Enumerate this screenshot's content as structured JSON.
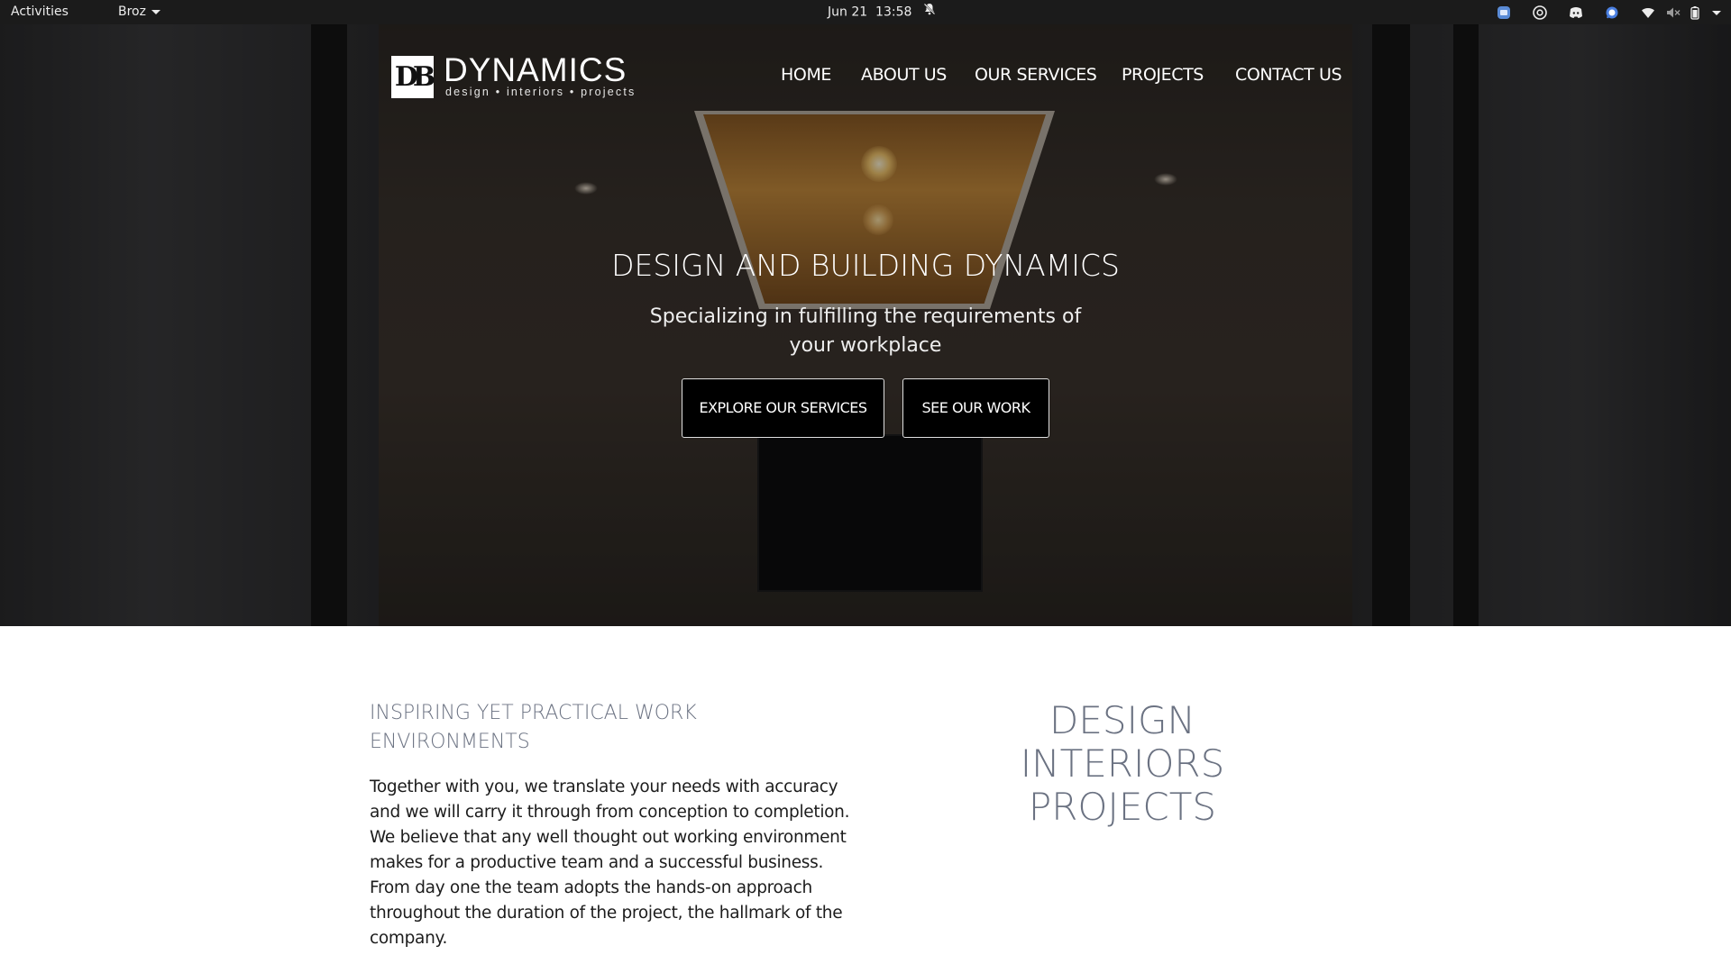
{
  "topbar": {
    "activities": "Activities",
    "app_name": "Broz",
    "date": "Jun 21",
    "time": "13:58",
    "tray_icons": [
      "app-indicator-icon",
      "chrome-icon",
      "discord-icon",
      "signal-icon",
      "wifi-icon",
      "volume-muted-icon",
      "battery-icon",
      "system-menu-chevron-icon"
    ]
  },
  "site": {
    "logo_mark": "DB",
    "brand": "DYNAMICS",
    "tagline": "design • interiors • projects",
    "nav": [
      "HOME",
      "ABOUT US",
      "OUR SERVICES",
      "PROJECTS",
      "CONTACT US"
    ]
  },
  "hero": {
    "title": "DESIGN AND BUILDING DYNAMICS",
    "subtitle": "Specializing in fulfilling the requirements of your workplace",
    "buttons": [
      "EXPLORE OUR SERVICES",
      "SEE OUR WORK"
    ]
  },
  "intro": {
    "heading": "INSPIRING YET PRACTICAL WORK ENVIRONMENTS",
    "body": "Together with you, we translate your needs with accuracy and we will carry it through from conception to completion. We believe that any well thought out working environment makes for a productive team and a successful business. From day one the team adopts the hands-on approach throughout the duration of the project, the hallmark of the company.",
    "tri_lines": [
      "DESIGN",
      "INTERIORS",
      "PROJECTS"
    ]
  },
  "colors": {
    "topbar_bg": "#1b1b1b",
    "button_bg": "#000000",
    "heading_gray": "#6b7282"
  }
}
